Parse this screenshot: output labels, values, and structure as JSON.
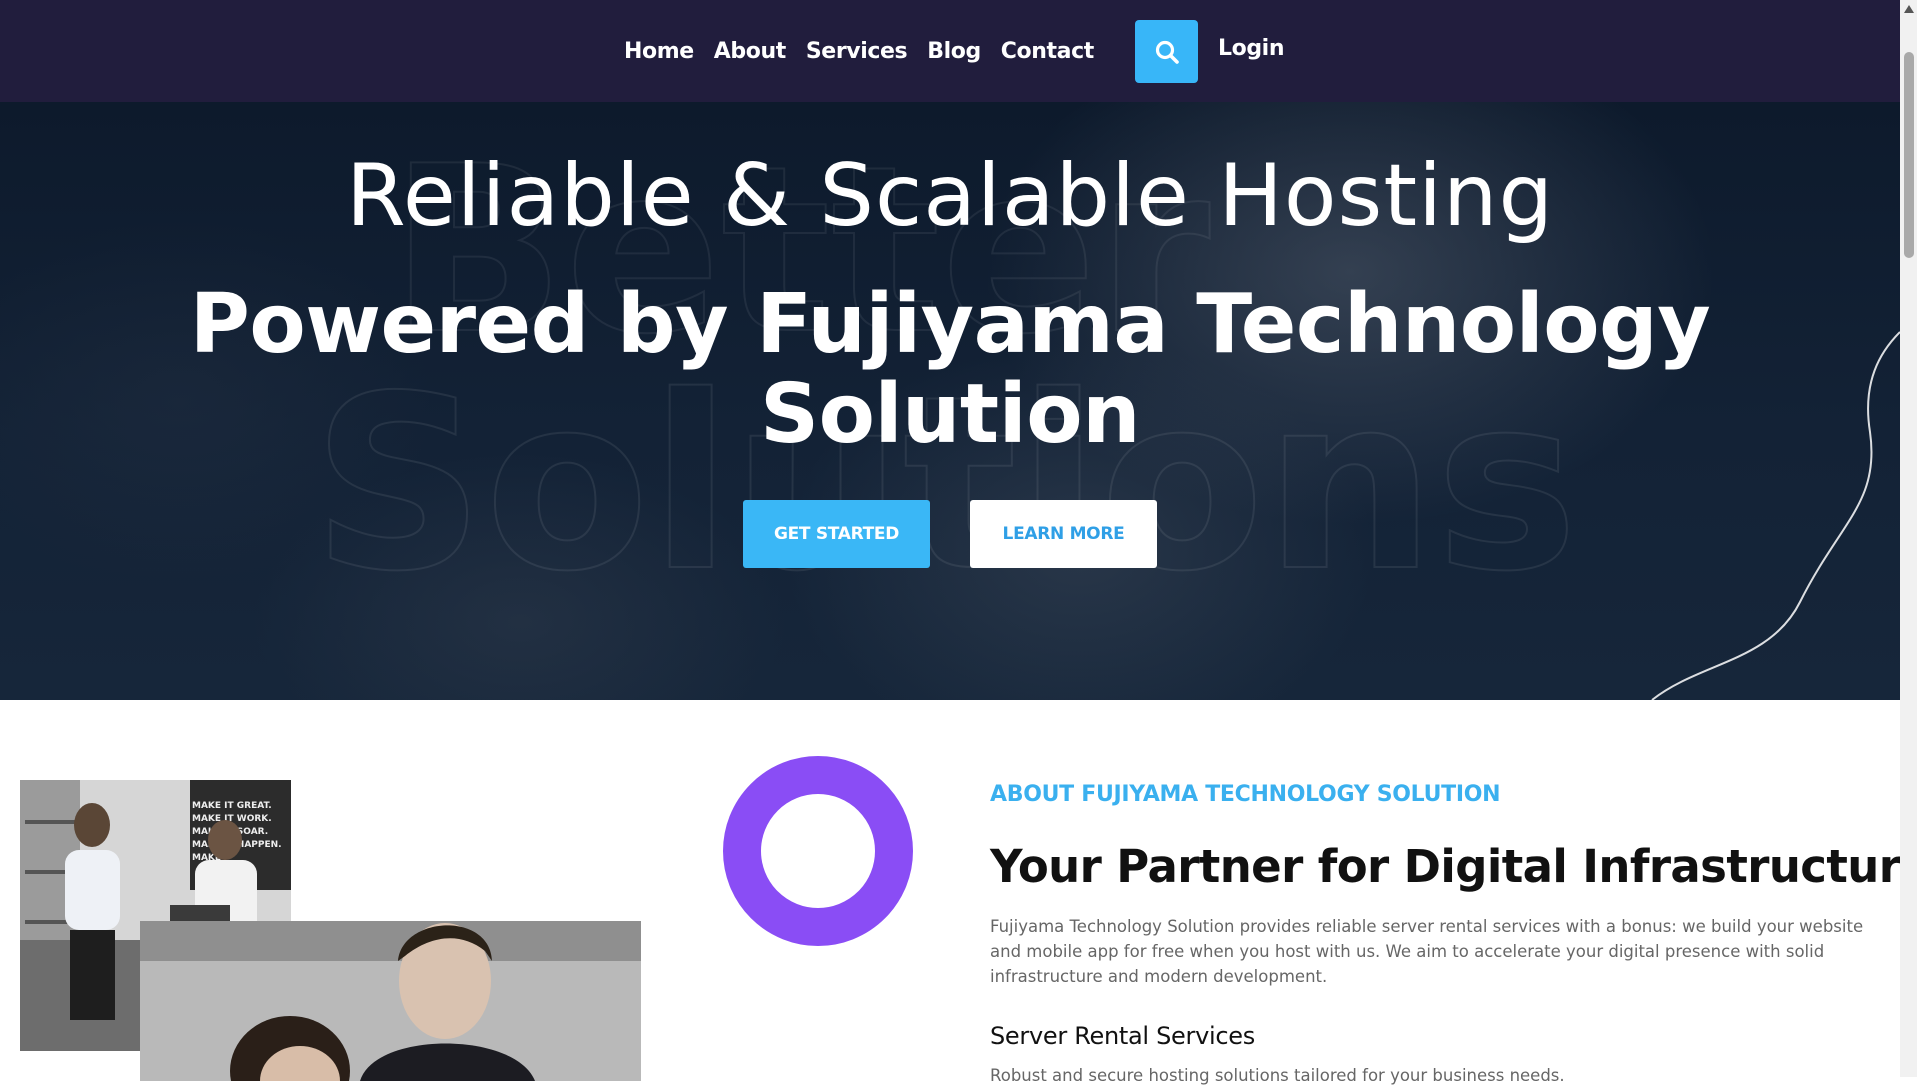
{
  "nav": {
    "links": [
      "Home",
      "About",
      "Services",
      "Blog",
      "Contact"
    ],
    "login": "Login",
    "search_icon": "search-icon"
  },
  "hero": {
    "title_line1": "Reliable & Scalable Hosting",
    "title_line2": "Powered by Fujiyama Technology Solution",
    "watermark": [
      "Better",
      "Solutions"
    ],
    "primary_cta": "GET STARTED",
    "secondary_cta": "LEARN MORE"
  },
  "about": {
    "eyebrow": "ABOUT FUJIYAMA TECHNOLOGY SOLUTION",
    "heading": "Your Partner for Digital Infrastructure",
    "body": "Fujiyama Technology Solution provides reliable server rental services with a bonus: we build your website and mobile app for free when you host with us. We aim to accelerate your digital presence with solid infrastructure and modern development.",
    "services_heading": "Server Rental Services",
    "services_sub": "Robust and secure hosting solutions tailored for your business needs.",
    "poster_text": "MAKE IT GREAT. MAKE IT WORK. MAKE IT SOAR. MAKE IT HAPPEN. MAKE"
  },
  "colors": {
    "nav_bg": "#211d3d",
    "accent_blue": "#3ab7f6",
    "ring_purple": "#8a4df5"
  }
}
